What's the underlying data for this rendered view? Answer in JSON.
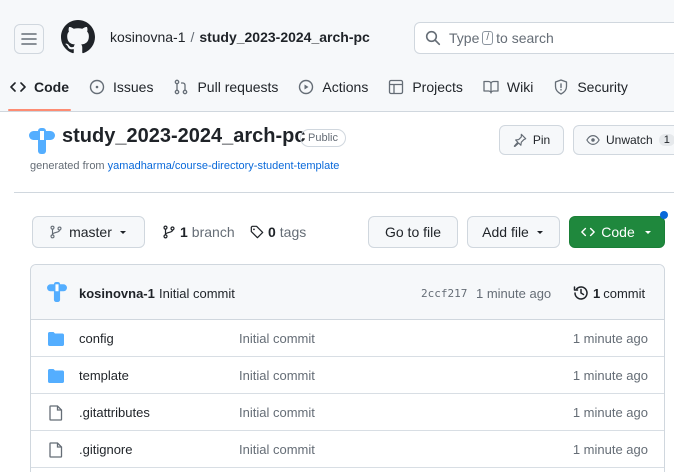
{
  "header": {
    "owner": "kosinovna-1",
    "separator": "/",
    "repo": "study_2023-2024_arch-pc",
    "search": {
      "prefix": "Type",
      "key": "/",
      "suffix": "to search"
    }
  },
  "nav": {
    "tabs": [
      {
        "label": "Code",
        "icon": "code-icon",
        "selected": true
      },
      {
        "label": "Issues",
        "icon": "issue-icon",
        "selected": false
      },
      {
        "label": "Pull requests",
        "icon": "pull-request-icon",
        "selected": false
      },
      {
        "label": "Actions",
        "icon": "play-icon",
        "selected": false
      },
      {
        "label": "Projects",
        "icon": "table-icon",
        "selected": false
      },
      {
        "label": "Wiki",
        "icon": "book-icon",
        "selected": false
      },
      {
        "label": "Security",
        "icon": "shield-icon",
        "selected": false
      }
    ]
  },
  "repo": {
    "title": "study_2023-2024_arch-pc",
    "visibility": "Public",
    "generated_prefix": "generated from",
    "template_link": "yamadharma/course-directory-student-template",
    "pin_label": "Pin",
    "unwatch_label": "Unwatch",
    "watch_count": "1"
  },
  "file_nav": {
    "branch": "master",
    "branch_count": "1",
    "branch_word": "branch",
    "tag_count": "0",
    "tag_word": "tags",
    "goto_label": "Go to file",
    "addfile_label": "Add file",
    "code_label": "Code"
  },
  "latest_commit": {
    "author": "kosinovna-1",
    "message": "Initial commit",
    "hash": "2ccf217",
    "time": "1 minute ago",
    "count": "1",
    "count_word": "commit"
  },
  "files": [
    {
      "name": "config",
      "type": "folder",
      "message": "Initial commit",
      "time": "1 minute ago"
    },
    {
      "name": "template",
      "type": "folder",
      "message": "Initial commit",
      "time": "1 minute ago"
    },
    {
      "name": ".gitattributes",
      "type": "file",
      "message": "Initial commit",
      "time": "1 minute ago"
    },
    {
      "name": ".gitignore",
      "type": "file",
      "message": "Initial commit",
      "time": "1 minute ago"
    }
  ],
  "colors": {
    "accent": "#0969da",
    "primary_button": "#1f883d",
    "folder": "#54aeff",
    "tab_underline": "#fd8c73"
  }
}
